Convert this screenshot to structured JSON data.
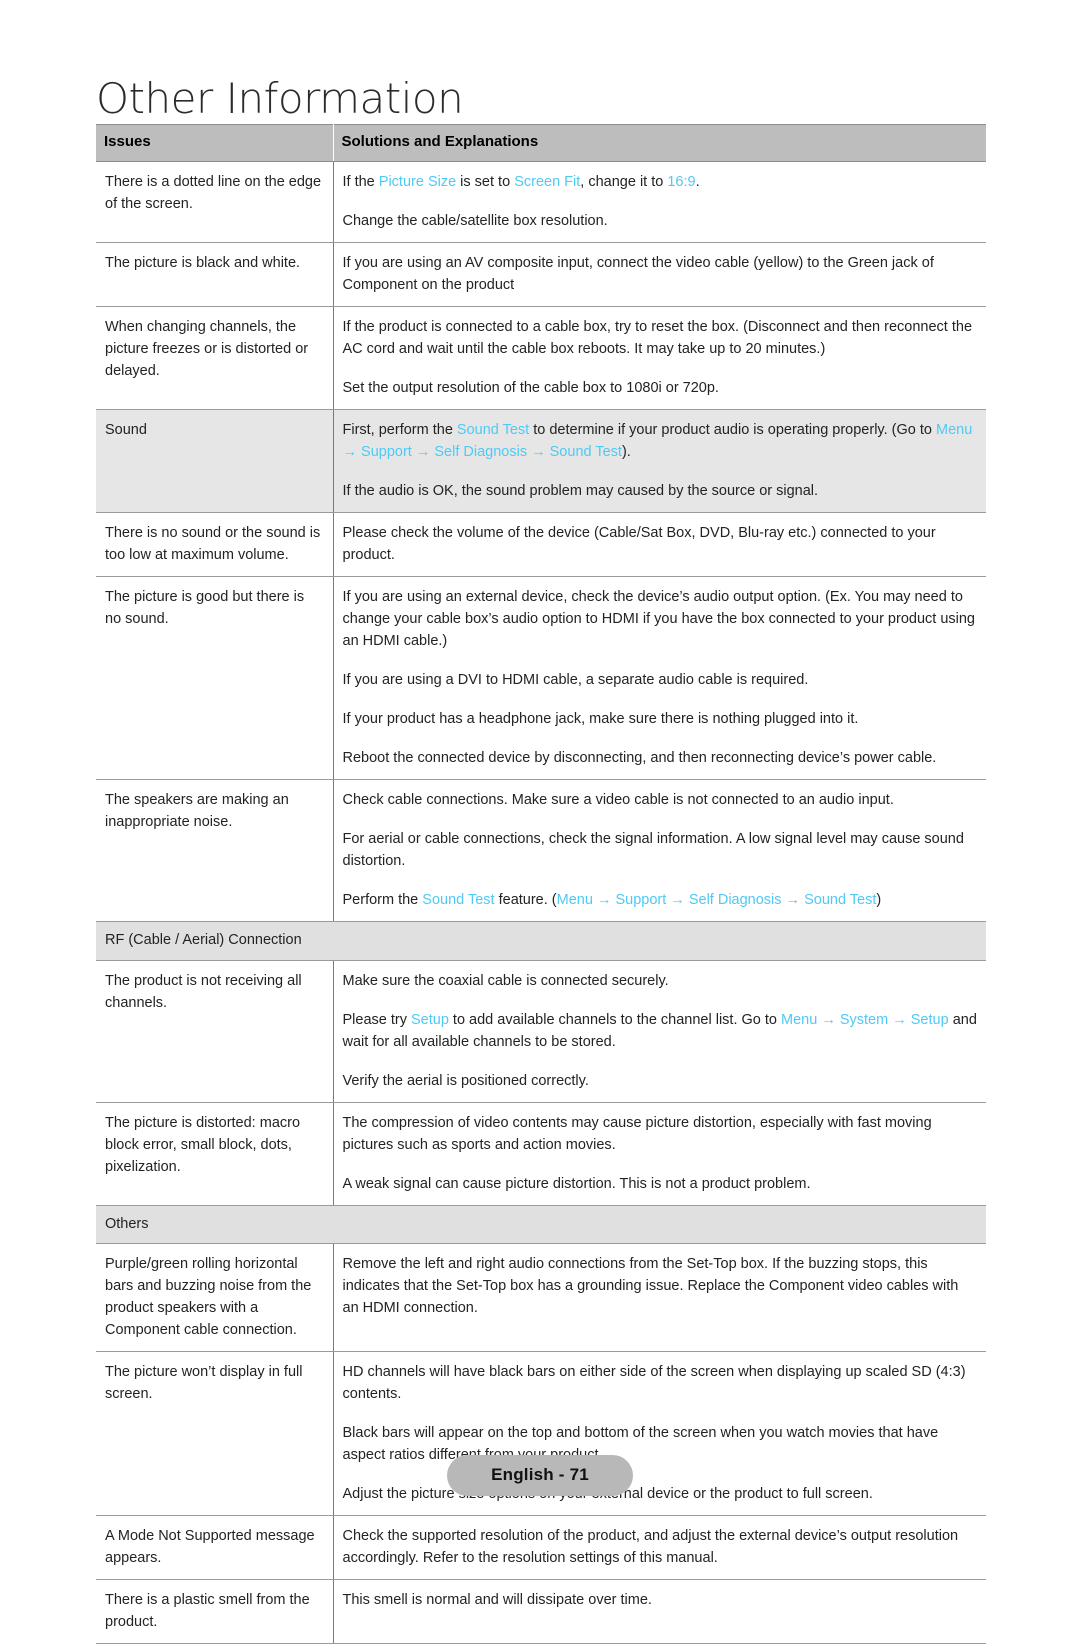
{
  "page": {
    "title": "Other Information",
    "footer_label": "English - 71",
    "highlight_color": "#4fc9f5",
    "header_bg": "#bdbdbd",
    "section_bg": "#e0e0e0",
    "shaded_row_bg": "#e6e6e6"
  },
  "table": {
    "columns": [
      "Issues",
      "Solutions and Explanations"
    ],
    "rows": [
      {
        "type": "data",
        "shaded": false,
        "issue": "There is a dotted line on the edge of the screen.",
        "solutions": [
          {
            "segments": [
              {
                "t": "If the ",
                "hl": false
              },
              {
                "t": "Picture Size",
                "hl": true
              },
              {
                "t": " is set to ",
                "hl": false
              },
              {
                "t": "Screen Fit",
                "hl": true
              },
              {
                "t": ", change it to ",
                "hl": false
              },
              {
                "t": "16:9",
                "hl": true
              },
              {
                "t": ".",
                "hl": false
              }
            ]
          },
          {
            "segments": [
              {
                "t": "Change the cable/satellite box resolution.",
                "hl": false
              }
            ]
          }
        ]
      },
      {
        "type": "data",
        "shaded": false,
        "issue": "The picture is black and white.",
        "solutions": [
          {
            "segments": [
              {
                "t": "If you are using an AV composite input, connect the video cable (yellow) to the Green jack of Component on the product",
                "hl": false
              }
            ]
          }
        ]
      },
      {
        "type": "data",
        "shaded": false,
        "issue": "When changing channels, the picture freezes or is distorted or delayed.",
        "solutions": [
          {
            "segments": [
              {
                "t": "If the product is connected to a cable box, try to reset the box. (Disconnect and then reconnect the AC cord and wait until the cable box reboots. It may take up to 20 minutes.)",
                "hl": false
              }
            ]
          },
          {
            "segments": [
              {
                "t": "Set the output resolution of the cable box to 1080i or 720p.",
                "hl": false
              }
            ]
          }
        ]
      },
      {
        "type": "data",
        "shaded": true,
        "issue": "Sound",
        "solutions": [
          {
            "segments": [
              {
                "t": "First, perform the ",
                "hl": false
              },
              {
                "t": "Sound Test",
                "hl": true
              },
              {
                "t": " to determine if your product audio is operating properly. (Go to ",
                "hl": false
              },
              {
                "t": "Menu",
                "hl": true
              },
              {
                "t": " → ",
                "hl": true
              },
              {
                "t": "Support",
                "hl": true
              },
              {
                "t": " → ",
                "hl": true
              },
              {
                "t": "Self Diagnosis",
                "hl": true
              },
              {
                "t": " → ",
                "hl": true
              },
              {
                "t": "Sound Test",
                "hl": true
              },
              {
                "t": ").",
                "hl": false
              }
            ]
          },
          {
            "segments": [
              {
                "t": "If the audio is OK, the sound problem may caused by the source or signal.",
                "hl": false
              }
            ]
          }
        ]
      },
      {
        "type": "data",
        "shaded": false,
        "issue": "There is no sound or the sound is too low at maximum volume.",
        "solutions": [
          {
            "segments": [
              {
                "t": "Please check the volume of the device (Cable/Sat Box, DVD, Blu-ray etc.) connected to your product.",
                "hl": false
              }
            ]
          }
        ]
      },
      {
        "type": "data",
        "shaded": false,
        "issue": "The picture is good but there is no sound.",
        "solutions": [
          {
            "segments": [
              {
                "t": "If you are using an external device, check the device’s audio output option. (Ex. You may need to change your cable box’s audio option to HDMI if you have the box connected to your product using an HDMI cable.)",
                "hl": false
              }
            ]
          },
          {
            "segments": [
              {
                "t": "If you are using a DVI to HDMI cable, a separate audio cable is required.",
                "hl": false
              }
            ]
          },
          {
            "segments": [
              {
                "t": "If your product has a headphone jack, make sure there is nothing plugged into it.",
                "hl": false
              }
            ]
          },
          {
            "segments": [
              {
                "t": "Reboot the connected device by disconnecting, and then reconnecting device’s power cable.",
                "hl": false
              }
            ]
          }
        ]
      },
      {
        "type": "data",
        "shaded": false,
        "issue": "The speakers are making an inappropriate noise.",
        "solutions": [
          {
            "segments": [
              {
                "t": "Check cable connections. Make sure a video cable is not connected to an audio input.",
                "hl": false
              }
            ]
          },
          {
            "segments": [
              {
                "t": "For aerial or cable connections, check the signal information. A low signal level may cause sound distortion.",
                "hl": false
              }
            ]
          },
          {
            "segments": [
              {
                "t": "Perform the ",
                "hl": false
              },
              {
                "t": "Sound Test",
                "hl": true
              },
              {
                "t": " feature. (",
                "hl": false
              },
              {
                "t": "Menu",
                "hl": true
              },
              {
                "t": " → ",
                "hl": true
              },
              {
                "t": "Support",
                "hl": true
              },
              {
                "t": " → ",
                "hl": true
              },
              {
                "t": "Self Diagnosis",
                "hl": true
              },
              {
                "t": " → ",
                "hl": true
              },
              {
                "t": "Sound Test",
                "hl": true
              },
              {
                "t": ")",
                "hl": false
              }
            ]
          }
        ]
      },
      {
        "type": "section",
        "label": "RF (Cable / Aerial) Connection"
      },
      {
        "type": "data",
        "shaded": false,
        "issue": "The product is not receiving all channels.",
        "solutions": [
          {
            "segments": [
              {
                "t": "Make sure the coaxial cable is connected securely.",
                "hl": false
              }
            ]
          },
          {
            "segments": [
              {
                "t": "Please try ",
                "hl": false
              },
              {
                "t": "Setup",
                "hl": true
              },
              {
                "t": " to add available channels to the channel list. Go to ",
                "hl": false
              },
              {
                "t": "Menu",
                "hl": true
              },
              {
                "t": " → ",
                "hl": true
              },
              {
                "t": "System",
                "hl": true
              },
              {
                "t": " → ",
                "hl": true
              },
              {
                "t": "Setup",
                "hl": true
              },
              {
                "t": " and wait for all available channels to be stored.",
                "hl": false
              }
            ]
          },
          {
            "segments": [
              {
                "t": "Verify the aerial is positioned correctly.",
                "hl": false
              }
            ]
          }
        ]
      },
      {
        "type": "data",
        "shaded": false,
        "issue": "The picture is distorted: macro block error, small block, dots, pixelization.",
        "solutions": [
          {
            "segments": [
              {
                "t": "The compression of video contents may cause picture distortion, especially with fast moving pictures such as sports and action movies.",
                "hl": false
              }
            ]
          },
          {
            "segments": [
              {
                "t": "A weak signal can cause picture distortion. This is not a product problem.",
                "hl": false
              }
            ]
          }
        ]
      },
      {
        "type": "section",
        "label": "Others"
      },
      {
        "type": "data",
        "shaded": false,
        "issue": "Purple/green rolling horizontal bars and buzzing noise from the product speakers with a Component cable connection.",
        "solutions": [
          {
            "segments": [
              {
                "t": "Remove the left and right audio connections from the Set-Top box. If the buzzing stops, this indicates that the Set-Top box has a grounding issue. Replace the Component video cables with an HDMI connection.",
                "hl": false
              }
            ]
          }
        ]
      },
      {
        "type": "data",
        "shaded": false,
        "issue": "The picture won’t display in full screen.",
        "solutions": [
          {
            "segments": [
              {
                "t": "HD channels will have black bars on either side of the screen when displaying up scaled SD (4:3) contents.",
                "hl": false
              }
            ]
          },
          {
            "segments": [
              {
                "t": "Black bars will appear on the top and bottom of the screen when you watch movies that have aspect ratios different from your product.",
                "hl": false
              }
            ]
          },
          {
            "segments": [
              {
                "t": "Adjust the picture size options on your external device or the product to full screen.",
                "hl": false
              }
            ]
          }
        ]
      },
      {
        "type": "data",
        "shaded": false,
        "issue": "A Mode Not Supported message appears.",
        "solutions": [
          {
            "segments": [
              {
                "t": "Check the supported resolution of the product, and adjust the external device’s output resolution accordingly. Refer to the resolution settings of this manual.",
                "hl": false
              }
            ]
          }
        ]
      },
      {
        "type": "data",
        "shaded": false,
        "issue": "There is a plastic smell from the product.",
        "solutions": [
          {
            "segments": [
              {
                "t": "This smell is normal and will dissipate over time.",
                "hl": false
              }
            ]
          }
        ]
      }
    ]
  }
}
